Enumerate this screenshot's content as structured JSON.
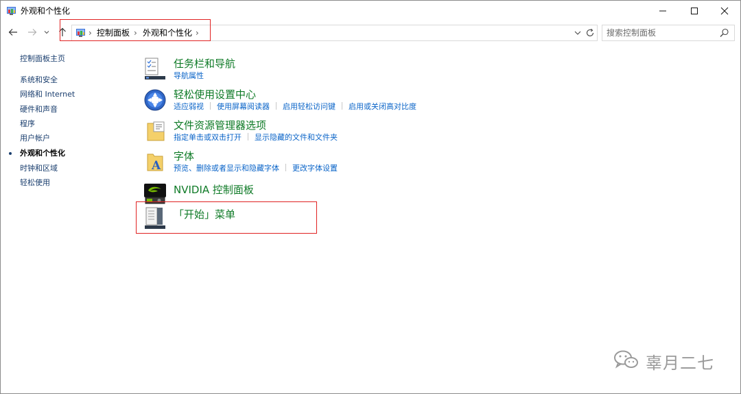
{
  "window": {
    "title": "外观和个性化"
  },
  "nav": {
    "breadcrumbs": [
      "控制面板",
      "外观和个性化"
    ],
    "search_placeholder": "搜索控制面板"
  },
  "sidebar": {
    "home": "控制面板主页",
    "items": [
      {
        "label": "系统和安全",
        "active": false
      },
      {
        "label": "网络和 Internet",
        "active": false
      },
      {
        "label": "硬件和声音",
        "active": false
      },
      {
        "label": "程序",
        "active": false
      },
      {
        "label": "用户帐户",
        "active": false
      },
      {
        "label": "外观和个性化",
        "active": true
      },
      {
        "label": "时钟和区域",
        "active": false
      },
      {
        "label": "轻松使用",
        "active": false
      }
    ]
  },
  "categories": [
    {
      "title": "任务栏和导航",
      "icon": "taskbar-icon",
      "links": [
        "导航属性"
      ]
    },
    {
      "title": "轻松使用设置中心",
      "icon": "ease-of-access-icon",
      "links": [
        "适应弱视",
        "使用屏幕阅读器",
        "启用轻松访问键",
        "启用或关闭高对比度"
      ]
    },
    {
      "title": "文件资源管理器选项",
      "icon": "folder-options-icon",
      "links": [
        "指定单击或双击打开",
        "显示隐藏的文件和文件夹"
      ]
    },
    {
      "title": "字体",
      "icon": "fonts-folder-icon",
      "links": [
        "预览、删除或者显示和隐藏字体",
        "更改字体设置"
      ]
    },
    {
      "title": "NVIDIA 控制面板",
      "icon": "nvidia-icon",
      "links": []
    },
    {
      "title": "「开始」菜单",
      "icon": "start-menu-icon",
      "links": []
    }
  ],
  "watermark": {
    "text": "辜月二七"
  },
  "colors": {
    "category_title": "#0e7a26",
    "link": "#0a64c8",
    "highlight_box": "#e02020"
  }
}
